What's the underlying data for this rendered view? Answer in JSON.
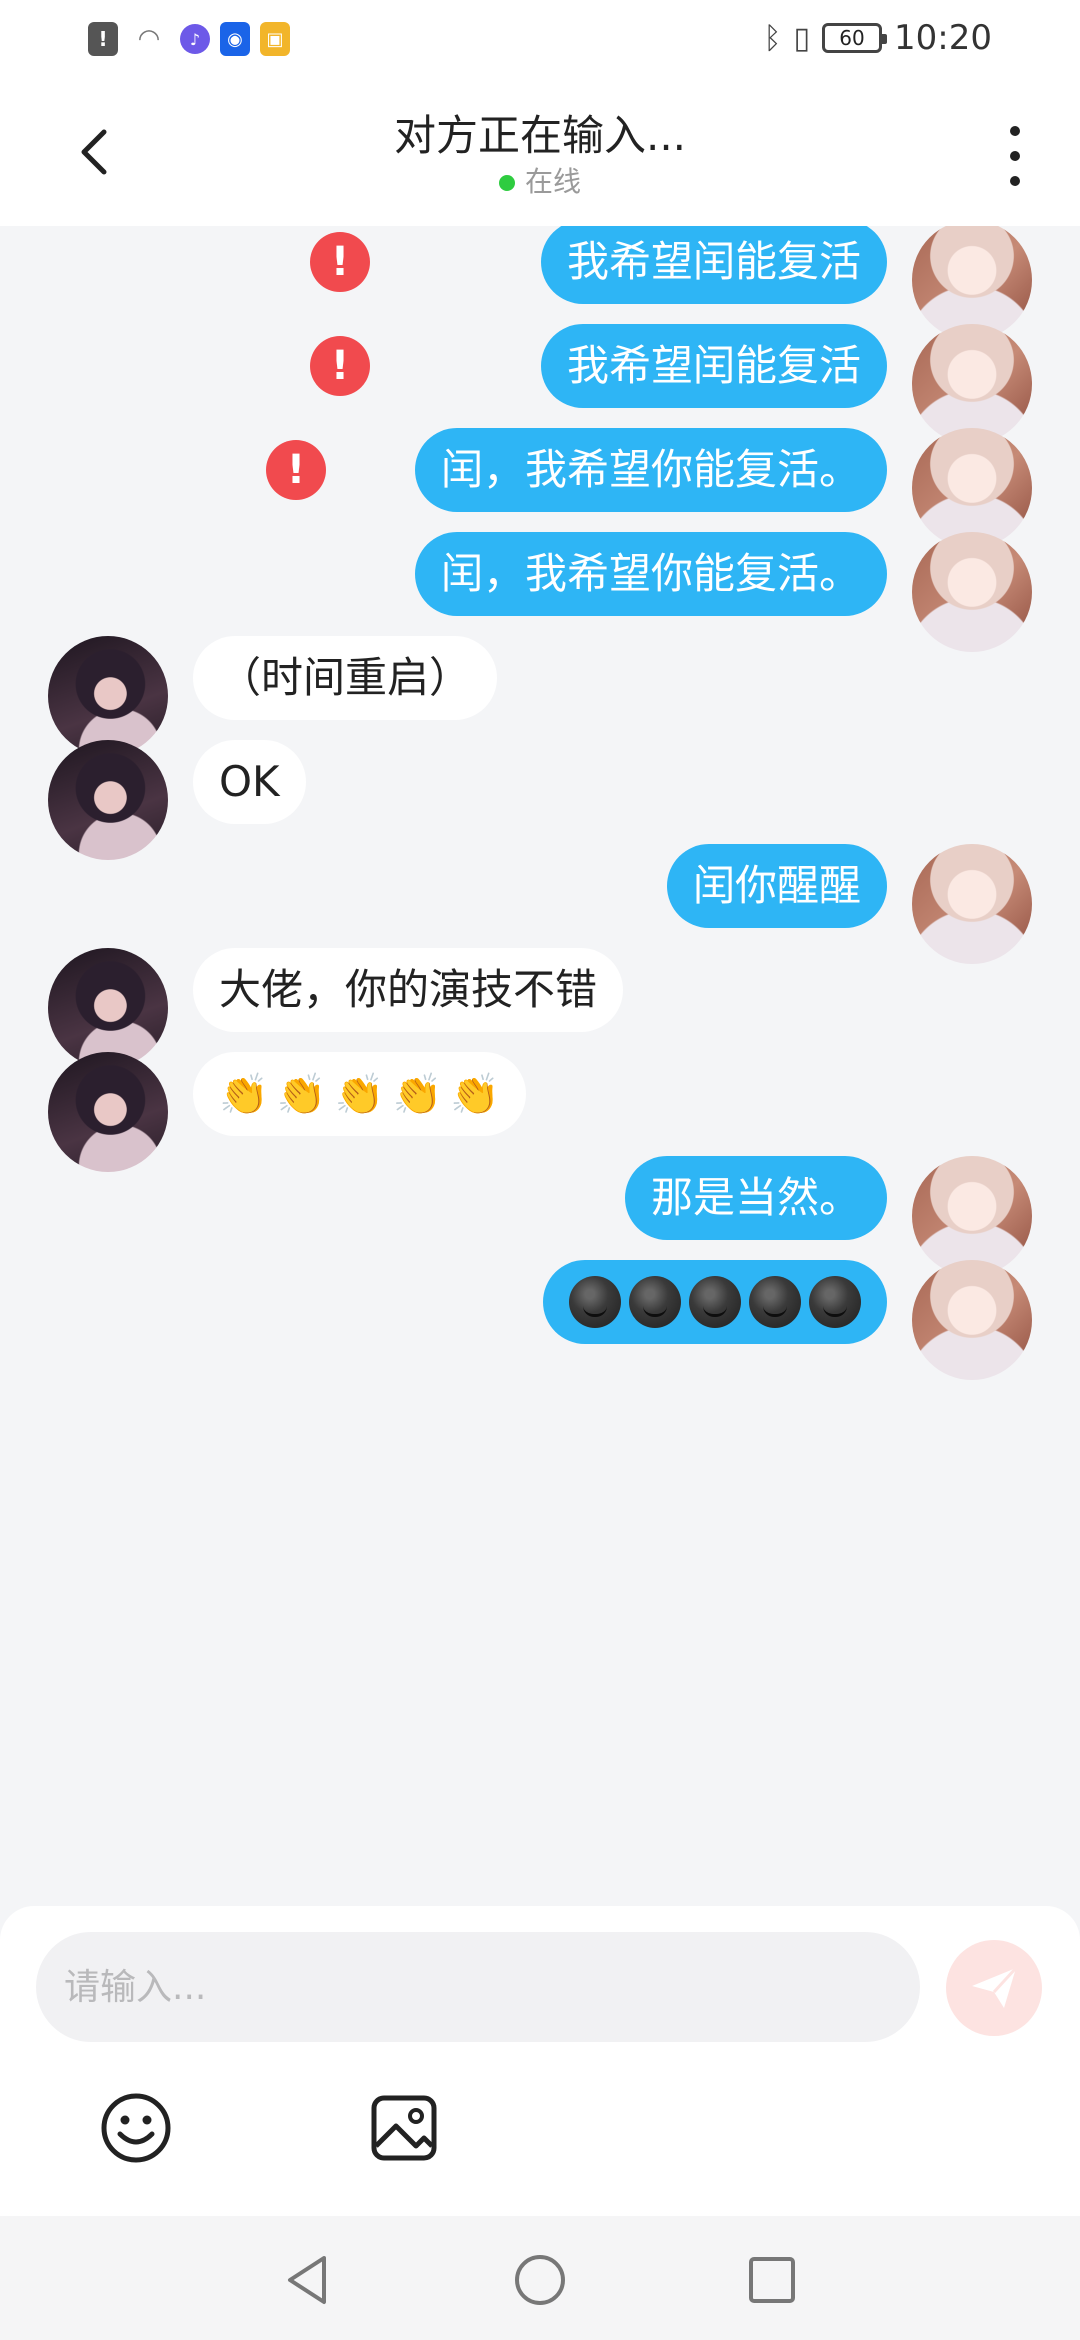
{
  "status_bar": {
    "time": "10:20",
    "battery": "60",
    "icons": [
      "alert-icon",
      "wifi-icon",
      "music-icon",
      "lightbulb-icon",
      "cup-icon",
      "bluetooth-icon",
      "vibrate-icon"
    ]
  },
  "header": {
    "title": "对方正在输入...",
    "status": "在线",
    "status_color": "#2ecc40"
  },
  "messages": [
    {
      "side": "me",
      "text": "我希望闰能复活",
      "failed": true
    },
    {
      "side": "me",
      "text": "我希望闰能复活",
      "failed": true
    },
    {
      "side": "me",
      "text": "闰，我希望你能复活。",
      "failed": true
    },
    {
      "side": "me",
      "text": "闰，我希望你能复活。",
      "failed": false
    },
    {
      "side": "them",
      "text": "（时间重启）"
    },
    {
      "side": "them",
      "text": "OK"
    },
    {
      "side": "me",
      "text": "闰你醒醒",
      "failed": false
    },
    {
      "side": "them",
      "text": "大佬，你的演技不错"
    },
    {
      "side": "them",
      "emoji": "clapping-hands",
      "count": 5
    },
    {
      "side": "me",
      "text": "那是当然。",
      "failed": false
    },
    {
      "side": "me",
      "emoji": "dark-smirk-face",
      "count": 5,
      "failed": false
    }
  ],
  "failed_marker": "!",
  "composer": {
    "placeholder": "请输入..."
  },
  "colors": {
    "my_bubble": "#2eb5f5",
    "their_bubble": "#ffffff",
    "error": "#f14a4e",
    "send_button": "#fde3e1"
  }
}
